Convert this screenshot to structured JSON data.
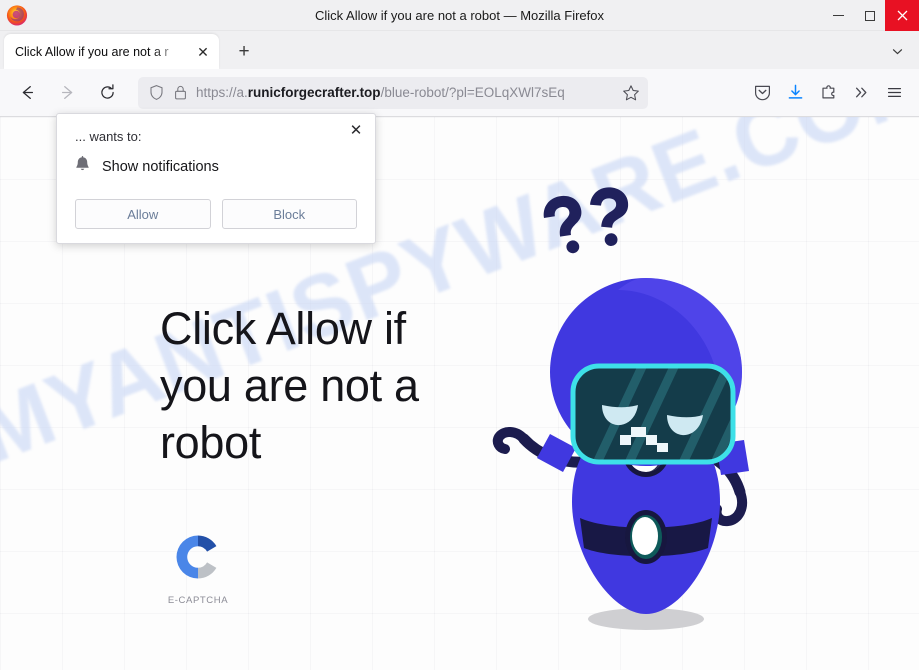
{
  "window": {
    "title": "Click Allow if you are not a robot — Mozilla Firefox",
    "app_icon": "firefox-logo",
    "minimize_label": "Minimize",
    "maximize_label": "Maximize",
    "close_label": "Close",
    "close_color": "#e81123"
  },
  "tabbar": {
    "tabs": [
      {
        "title": "Click Allow if you are not a r",
        "close_label": "✕"
      }
    ],
    "new_tab_label": "+",
    "list_all_tabs_label": "List all tabs"
  },
  "navbar": {
    "back_label": "Go back one page",
    "forward_label": "Go forward one page",
    "reload_label": "Reload current page",
    "url_prefix": "https://a.",
    "url_domain": "runicforgecrafter.top",
    "url_path": "/blue-robot/?pl=EOLqXWl7sEq",
    "shield_label": "Enhanced tracking protection",
    "lock_label": "Connection secure",
    "bookmark_label": "Bookmark this page",
    "tools": [
      {
        "name": "pocket-icon",
        "label": "Save to Pocket"
      },
      {
        "name": "download-icon",
        "label": "Downloads",
        "color": "#0a84ff"
      },
      {
        "name": "extensions-icon",
        "label": "Extensions"
      },
      {
        "name": "overflow-icon",
        "label": "More tools"
      },
      {
        "name": "hamburger-menu-icon",
        "label": "Open application menu"
      }
    ]
  },
  "popup": {
    "origin_text": "... wants to:",
    "permission_icon": "bell-icon",
    "permission_text": "Show notifications",
    "allow_label": "Allow",
    "block_label": "Block",
    "close_label": "✕"
  },
  "page": {
    "headline": "Click Allow if you are not a robot",
    "watermark": "MYANTISPYWARE.COM",
    "captcha_label": "E-CAPTCHA",
    "captcha_logo": "e-captcha-c-logo",
    "robot_illustration": "blue-robot-illustration",
    "question_marks": "??",
    "colors": {
      "robot_body": "#4038e0",
      "robot_dark": "#1c1c4e",
      "visor_border": "#3ee0e8",
      "visor_fill": "#143c4a",
      "captcha_dark_blue": "#2350a8",
      "captcha_light_blue": "#4a86e8",
      "captcha_gray": "#bdc1c6",
      "watermark": "#c9d7f5"
    }
  }
}
